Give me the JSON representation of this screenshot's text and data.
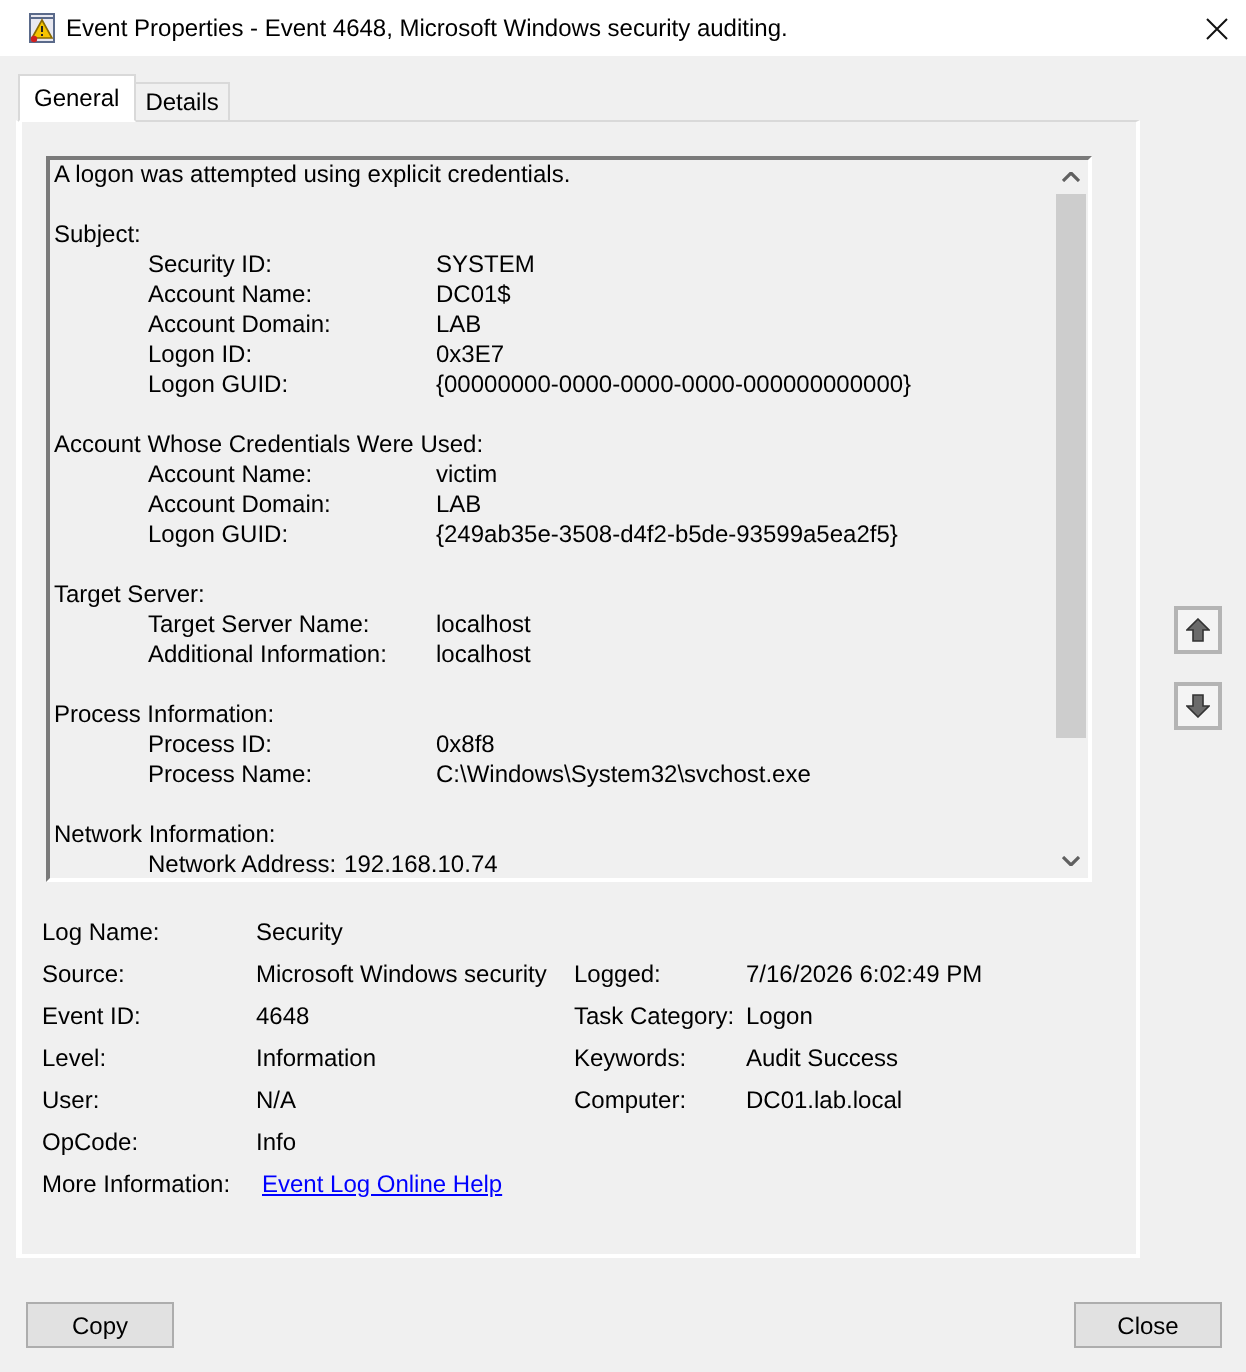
{
  "window": {
    "title": "Event Properties - Event 4648, Microsoft Windows security auditing."
  },
  "tabs": [
    {
      "label": "General",
      "selected": true
    },
    {
      "label": "Details",
      "selected": false
    }
  ],
  "description": {
    "summary": "A logon was attempted using explicit credentials.",
    "sections": [
      {
        "heading": "Subject:",
        "fields": [
          {
            "label": "Security ID:",
            "value": "SYSTEM",
            "kind": "tabbed"
          },
          {
            "label": "Account Name:",
            "value": "DC01$",
            "kind": "tabbed"
          },
          {
            "label": "Account Domain:",
            "value": "LAB",
            "kind": "tabbed"
          },
          {
            "label": "Logon ID:",
            "value": "0x3E7",
            "kind": "tabbed"
          },
          {
            "label": "Logon GUID:",
            "value": "{00000000-0000-0000-0000-000000000000}",
            "kind": "tabbed"
          }
        ]
      },
      {
        "heading": "Account Whose Credentials Were Used:",
        "fields": [
          {
            "label": "Account Name:",
            "value": "victim",
            "kind": "tabbed"
          },
          {
            "label": "Account Domain:",
            "value": "LAB",
            "kind": "tabbed"
          },
          {
            "label": "Logon GUID:",
            "value": "{249ab35e-3508-d4f2-b5de-93599a5ea2f5}",
            "kind": "tabbed"
          }
        ]
      },
      {
        "heading": "Target Server:",
        "fields": [
          {
            "label": "Target Server Name:",
            "value": "localhost",
            "kind": "tabbed"
          },
          {
            "label": "Additional Information:",
            "value": "localhost",
            "kind": "tabbed"
          }
        ]
      },
      {
        "heading": "Process Information:",
        "fields": [
          {
            "label": "Process ID:",
            "value": "0x8f8",
            "kind": "tabbed"
          },
          {
            "label": "Process Name:",
            "value": "C:\\Windows\\System32\\svchost.exe",
            "kind": "tabbed"
          }
        ]
      },
      {
        "heading": "Network Information:",
        "fields": [
          {
            "label": "Network Address:",
            "value": "192.168.10.74",
            "kind": "inline"
          }
        ]
      }
    ]
  },
  "details": [
    {
      "label": "Log Name:",
      "value": "Security"
    },
    {
      "label": "Source:",
      "value": "Microsoft Windows security",
      "label_2": "Logged:",
      "value_2": "7/16/2026 6:02:49 PM"
    },
    {
      "label": "Event ID:",
      "value": "4648",
      "label_2": "Task Category:",
      "value_2": "Logon"
    },
    {
      "label": "Level:",
      "value": "Information",
      "label_2": "Keywords:",
      "value_2": "Audit Success"
    },
    {
      "label": "User:",
      "value": "N/A",
      "label_2": "Computer:",
      "value_2": "DC01.lab.local"
    },
    {
      "label": "OpCode:",
      "value": "Info"
    },
    {
      "label": "More Information:",
      "link": "Event Log Online Help"
    }
  ],
  "buttons": [
    "Copy",
    "Close"
  ]
}
